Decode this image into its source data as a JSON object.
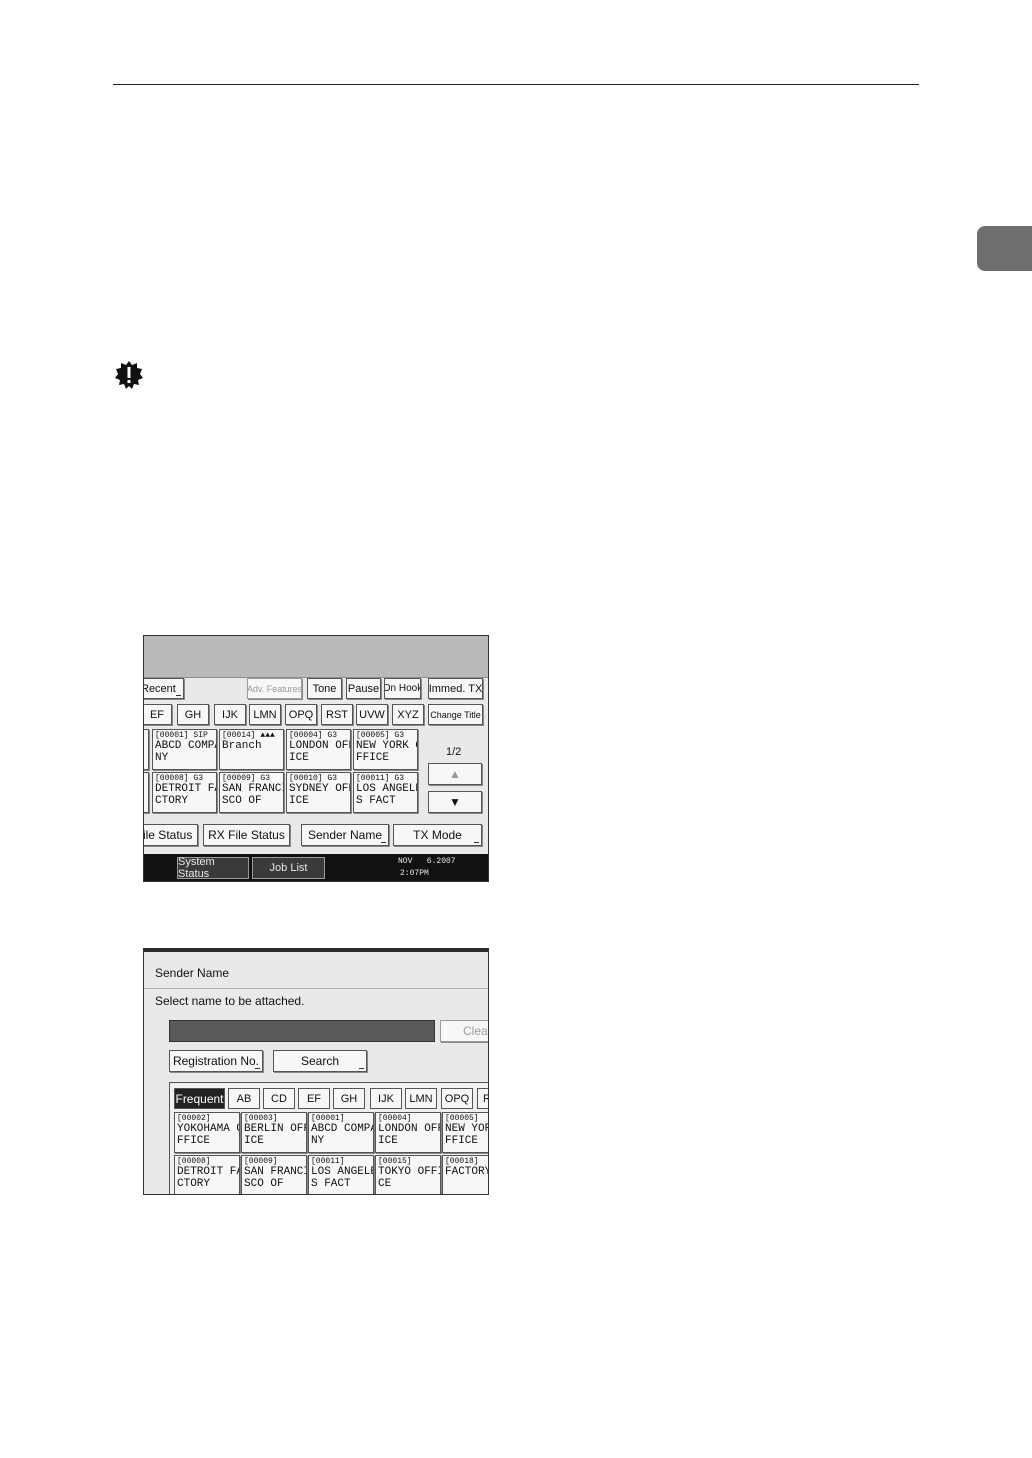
{
  "screen1": {
    "top_buttons": [
      {
        "label": "Recent"
      },
      {
        "label": "Adv. Features"
      },
      {
        "label": "Tone"
      },
      {
        "label": "Pause"
      },
      {
        "label": "On Hook"
      },
      {
        "label": "Immed. TX"
      }
    ],
    "index_tabs": [
      "EF",
      "GH",
      "IJK",
      "LMN",
      "OPQ",
      "RST",
      "UVW",
      "XYZ"
    ],
    "change_title": "Change Title",
    "destinations": [
      {
        "num": "[00001] SIP",
        "name": "ABCD COMPA\nNY"
      },
      {
        "num": "[00014] ▲▲▲",
        "name": "Branch"
      },
      {
        "num": "[00004] G3",
        "name": "LONDON OFF\nICE"
      },
      {
        "num": "[00005] G3",
        "name": "NEW YORK O\nFFICE"
      },
      {
        "num": "[00008] G3",
        "name": "DETROIT FA\nCTORY"
      },
      {
        "num": "[00009] G3",
        "name": "SAN FRANCI\nSCO OF"
      },
      {
        "num": "[00010] G3",
        "name": "SYDNEY OFF\nICE"
      },
      {
        "num": "[00011] G3",
        "name": "LOS ANGELE\nS FACT"
      }
    ],
    "page_indicator": "1/2",
    "bottom_buttons": [
      "File Status",
      "RX File Status",
      "Sender Name",
      "TX Mode"
    ],
    "status_bar": {
      "system_status": "System Status",
      "job_list": "Job List",
      "date": "NOV   6.2007",
      "time": "2:07PM"
    }
  },
  "screen2": {
    "title": "Sender Name",
    "prompt": "Select name to be attached.",
    "clear": "Clear",
    "registration_no": "Registration No.",
    "search": "Search",
    "tabs": [
      "Frequent",
      "AB",
      "CD",
      "EF",
      "GH",
      "IJK",
      "LMN",
      "OPQ",
      "R"
    ],
    "entries": [
      {
        "num": "[00002]",
        "name": "YOKOHAMA O\nFFICE"
      },
      {
        "num": "[00003]",
        "name": "BERLIN OFF\nICE"
      },
      {
        "num": "[00001]",
        "name": "ABCD COMPA\nNY"
      },
      {
        "num": "[00004]",
        "name": "LONDON OFF\nICE"
      },
      {
        "num": "[00005]",
        "name": "NEW YORK\nFFICE"
      },
      {
        "num": "[00008]",
        "name": "DETROIT FA\nCTORY"
      },
      {
        "num": "[00009]",
        "name": "SAN FRANCI\nSCO OF"
      },
      {
        "num": "[00011]",
        "name": "LOS ANGELE\nS FACT"
      },
      {
        "num": "[00015]",
        "name": "TOKYO OFFI\nCE"
      },
      {
        "num": "[00018]",
        "name": "FACTORY"
      }
    ]
  }
}
